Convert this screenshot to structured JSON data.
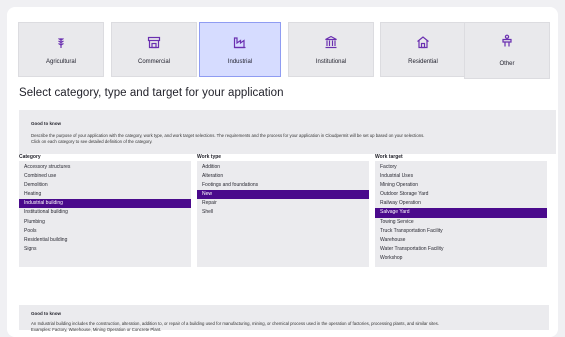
{
  "tiles": [
    {
      "label": "Agricultural",
      "icon": "wheat-icon",
      "selected": false
    },
    {
      "label": "Commercial",
      "icon": "storefront-icon",
      "selected": false
    },
    {
      "label": "Industrial",
      "icon": "factory-icon",
      "selected": true
    },
    {
      "label": "Institutional",
      "icon": "bank-building-icon",
      "selected": false
    },
    {
      "label": "Residential",
      "icon": "house-icon",
      "selected": false
    },
    {
      "label": "Other",
      "icon": "person-sign-icon",
      "selected": false
    }
  ],
  "heading": "Select category, type and target for your application",
  "info_top": {
    "title": "Good to know",
    "text_line1": "Describe the purpose of your application with the category, work type, and work target selections. The requirements and the process for your application in Cloudpermit will be set up based on your selections.",
    "text_line2": "Click on each category to see detailed definition of the category."
  },
  "columns": {
    "category": {
      "header": "Category",
      "items": [
        "Accessory structures",
        "Combined use",
        "Demolition",
        "Heating",
        "Industrial building",
        "Institutional building",
        "Plumbing",
        "Pools",
        "Residential building",
        "Signs"
      ],
      "selected": "Industrial building"
    },
    "work_type": {
      "header": "Work type",
      "items": [
        "Addition",
        "Alteration",
        "Footings and foundations",
        "New",
        "Repair",
        "Shell"
      ],
      "selected": "New"
    },
    "work_target": {
      "header": "Work target",
      "items": [
        "Factory",
        "Industrial Uses",
        "Mining Operation",
        "Outdoor Storage Yard",
        "Railway Operation",
        "Salvage Yard",
        "Towing Service",
        "Truck Transportation Facility",
        "Warehouse",
        "Water Transportation Facility",
        "Workshop"
      ],
      "selected": "Salvage Yard"
    }
  },
  "info_bottom": {
    "title": "Good to know",
    "text_line1": "An Industrial building includes the construction, alteration, addition to, or repair of a building used for manufacturing, mining, or chemical process used in the operation of factories, processing plants, and similar sites.",
    "text_line2": "Examples: Factory, Warehouse, Mining Operation or Concrete Plant."
  },
  "colors": {
    "accent": "#4a0a8c",
    "tile_selected": "#d6dcff",
    "icon": "#5b2aa0"
  }
}
